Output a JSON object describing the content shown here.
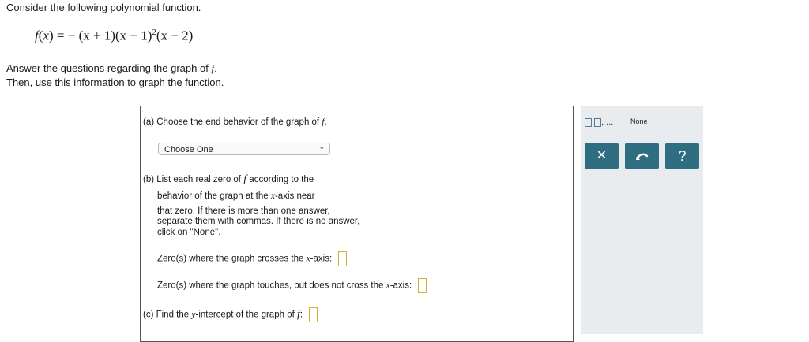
{
  "intro": "Consider the following polynomial function.",
  "function": {
    "lhs": "f",
    "x": "x",
    "eq": "= −",
    "f1": "(x + 1)",
    "f2": "(x − 1)",
    "exp": "2",
    "f3": "(x − 2)"
  },
  "instructions": {
    "line1": "Answer the questions regarding the graph of",
    "line1_var": "f",
    "line2": "Then, use this information to graph the function."
  },
  "part_a": {
    "label": "(a) Choose the end behavior of the graph of",
    "var": "f",
    "select_value": "Choose One"
  },
  "part_b": {
    "label": "(b) List each real zero of",
    "var": "f",
    "label_rest": "according to the",
    "line2": "behavior of the graph at the",
    "axis_var": "x",
    "line2_rest": "-axis near",
    "note": "that zero. If there is more than one answer, separate them with commas. If there is no answer, click on \"None\".",
    "crosses_pre": "Zero(s) where the graph crosses the",
    "crosses_post": "-axis:",
    "touches_pre": "Zero(s) where the graph touches, but does not cross the",
    "touches_post": "-axis:"
  },
  "part_c": {
    "label": "(c) Find the",
    "yvar": "y",
    "label_mid": "-intercept of the graph of",
    "fvar": "f",
    "colon": ":"
  },
  "toolbar": {
    "list_sep": ",",
    "list_more": ", ...",
    "none_label": "None",
    "clear_icon": "times-icon",
    "undo_icon": "undo-icon",
    "help_icon": "question-icon",
    "button_color": "#2f6d80"
  }
}
